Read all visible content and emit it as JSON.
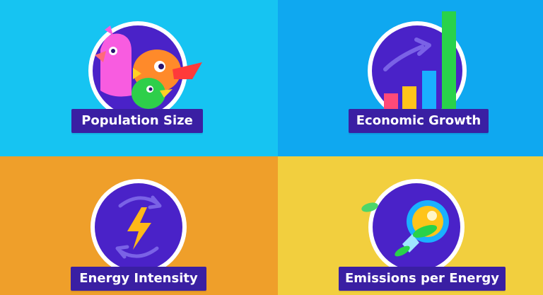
{
  "panels": [
    {
      "label": "Population Size",
      "bg": "#16c4f2",
      "icon": "people-birds-icon"
    },
    {
      "label": "Economic Growth",
      "bg": "#0fa8f0",
      "icon": "growth-chart-icon"
    },
    {
      "label": "Energy Intensity",
      "bg": "#ef9f2a",
      "icon": "lightning-cycle-icon"
    },
    {
      "label": "Emissions per Energy",
      "bg": "#f2cf3e",
      "icon": "leaf-bulb-icon"
    }
  ],
  "colors": {
    "label_bg": "#3a1fa3",
    "circle_fill": "#4a22c8",
    "circle_ring": "#ffffff"
  }
}
